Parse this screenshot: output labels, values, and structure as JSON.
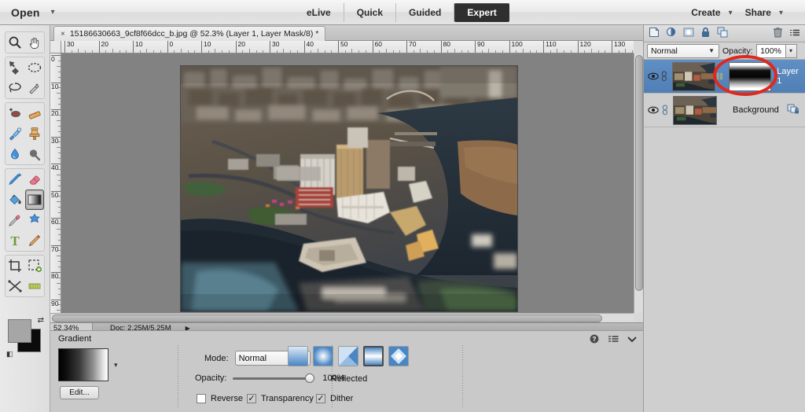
{
  "topbar": {
    "open_label": "Open",
    "open_caret": "▾",
    "mode_tabs": [
      {
        "label": "eLive",
        "active": false
      },
      {
        "label": "Quick",
        "active": false
      },
      {
        "label": "Guided",
        "active": false
      },
      {
        "label": "Expert",
        "active": true
      }
    ],
    "create_label": "Create",
    "create_caret": "▾",
    "share_label": "Share",
    "share_caret": "▾"
  },
  "document": {
    "tab_close": "×",
    "tab_title": "15186630663_9cf8f66dcc_b.jpg @ 52.3% (Layer 1, Layer Mask/8) *"
  },
  "rulers": {
    "horizontal_ticks": [
      "30",
      "20",
      "10",
      "0",
      "10",
      "20",
      "30",
      "40",
      "50",
      "60",
      "70",
      "80",
      "90",
      "100",
      "110",
      "120",
      "130"
    ],
    "vertical_ticks": [
      "0",
      "10",
      "20",
      "30",
      "40",
      "50",
      "60",
      "70",
      "80",
      "90"
    ],
    "unit": "mm"
  },
  "statusbar": {
    "zoom": "52.34%",
    "doc_size": "Doc: 2.25M/5.25M",
    "arrow": "▶"
  },
  "options_panel": {
    "title": "Gradient",
    "edit_label": "Edit...",
    "gradient_caret": "▾",
    "mode_label": "Mode:",
    "mode_value": "Normal",
    "mode_arrow": "▼",
    "opacity_label": "Opacity:",
    "opacity_value": "100%",
    "opacity_percent": 100,
    "checkboxes": [
      {
        "label": "Reverse",
        "checked": false
      },
      {
        "label": "Transparency",
        "checked": true
      },
      {
        "label": "Dither",
        "checked": true
      }
    ],
    "gradient_types": [
      {
        "name": "linear-gradient-type",
        "selected": false
      },
      {
        "name": "radial-gradient-type",
        "selected": false
      },
      {
        "name": "angle-gradient-type",
        "selected": false
      },
      {
        "name": "reflected-gradient-type",
        "selected": true
      },
      {
        "name": "diamond-gradient-type",
        "selected": false
      }
    ],
    "gradient_type_label": "Reflected",
    "help_icon": "?",
    "menu_icon": "≡",
    "collapse_icon": "⌄"
  },
  "layers_panel": {
    "toolbar_icons": [
      "new-layer-icon",
      "adjustment-layer-icon",
      "layer-mask-icon",
      "lock-icon",
      "duplicate-layer-icon",
      "trash-icon",
      "panel-menu-icon"
    ],
    "blend_mode": "Normal",
    "blend_arrow": "▼",
    "opacity_label": "Opacity:",
    "opacity_value": "100%",
    "opacity_arrow": "▾",
    "layers": [
      {
        "name": "Layer 1",
        "selected": true,
        "visible": true,
        "has_mask": true,
        "eye_icon": "eye-icon",
        "link_icon": "link-icon",
        "mask_link_icon": "mask-link-icon"
      },
      {
        "name": "Background",
        "selected": false,
        "visible": true,
        "has_mask": false,
        "eye_icon": "eye-icon",
        "link_icon": "link-icon",
        "lock_icon": "lock-badge-icon"
      }
    ]
  },
  "toolbar": {
    "groups": [
      {
        "tools": [
          {
            "name": "zoom-tool",
            "selected": false
          },
          {
            "name": "hand-tool",
            "selected": false
          }
        ]
      },
      {
        "tools": [
          {
            "name": "move-tool",
            "selected": false
          },
          {
            "name": "marquee-select-tool",
            "selected": false
          },
          {
            "name": "lasso-tool",
            "selected": false
          },
          {
            "name": "quick-selection-tool",
            "selected": false
          }
        ]
      },
      {
        "tools": [
          {
            "name": "red-eye-removal-tool",
            "selected": false
          },
          {
            "name": "straighten-tool",
            "selected": false
          },
          {
            "name": "spot-healing-brush-tool",
            "selected": false
          },
          {
            "name": "clone-stamp-tool",
            "selected": false
          },
          {
            "name": "blur-tool",
            "selected": false
          },
          {
            "name": "dodge-burn-tool",
            "selected": false
          }
        ]
      },
      {
        "tools": [
          {
            "name": "brush-tool",
            "selected": false
          },
          {
            "name": "eraser-tool",
            "selected": false
          },
          {
            "name": "paint-bucket-tool",
            "selected": false
          },
          {
            "name": "gradient-tool",
            "selected": true
          },
          {
            "name": "eyedropper-tool",
            "selected": false
          },
          {
            "name": "custom-shape-tool",
            "selected": false
          },
          {
            "name": "type-tool",
            "selected": false
          },
          {
            "name": "pencil-tool",
            "selected": false
          }
        ]
      },
      {
        "tools": [
          {
            "name": "crop-tool",
            "selected": false
          },
          {
            "name": "cookie-cutter-tool",
            "selected": false
          },
          {
            "name": "recompose-tool",
            "selected": false
          },
          {
            "name": "content-aware-move-tool",
            "selected": false
          }
        ]
      }
    ],
    "foreground_color": "#a6a6a6",
    "background_color": "#0b0b0b",
    "swap_icon": "swap-colors-icon",
    "default_icon": "default-colors-icon"
  },
  "annotation": {
    "shape": "red-ellipse-highlight",
    "color": "#e0281e",
    "target": "layer-mask-thumbnail"
  }
}
